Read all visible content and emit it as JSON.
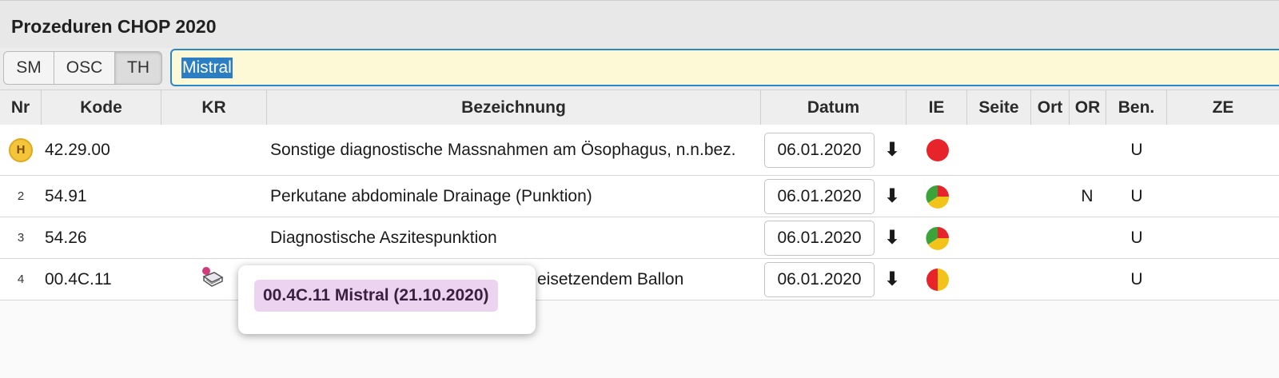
{
  "panel": {
    "title": "Prozeduren CHOP 2020"
  },
  "toolbar": {
    "segments": [
      {
        "label": "SM"
      },
      {
        "label": "OSC"
      },
      {
        "label": "TH"
      }
    ],
    "search": {
      "value": "Mistral"
    }
  },
  "table": {
    "headers": {
      "nr": "Nr",
      "kode": "Kode",
      "kr": "KR",
      "bezeichnung": "Bezeichnung",
      "datum": "Datum",
      "ie": "IE",
      "seite": "Seite",
      "ort": "Ort",
      "or": "OR",
      "ben": "Ben.",
      "ze": "ZE"
    },
    "rows": [
      {
        "nr": "H",
        "kode": "42.29.00",
        "bezeichnung": "Sonstige diagnostische Massnahmen am Ösophagus, n.n.bez.",
        "datum": "06.01.2020",
        "ie_status": "red",
        "or": "",
        "ben": "U"
      },
      {
        "nr": "2",
        "kode": "54.91",
        "bezeichnung": "Perkutane abdominale Drainage (Punktion)",
        "datum": "06.01.2020",
        "ie_status": "tri-color",
        "or": "N",
        "ben": "U"
      },
      {
        "nr": "3",
        "kode": "54.26",
        "bezeichnung": "Diagnostische Aszitespunktion",
        "datum": "06.01.2020",
        "ie_status": "tri-color",
        "or": "",
        "ben": "U"
      },
      {
        "nr": "4",
        "kode": "00.4C.11",
        "bezeichnung": "eisetzendem Ballon",
        "datum": "06.01.2020",
        "ie_status": "red-yellow",
        "or": "",
        "ben": "U"
      }
    ]
  },
  "tooltip": {
    "text": "00.4C.11  Mistral (21.10.2020)"
  },
  "icons": {
    "row_action": "arrow-down-icon",
    "kr": "catalog-book-icon",
    "main_badge": "H"
  },
  "colors": {
    "ie_red": "#e8242b",
    "ie_green": "#3aa33a",
    "ie_yellow": "#f2c318",
    "search_bg": "#fdf8d6",
    "tooltip_chip": "#ecd3ef"
  }
}
